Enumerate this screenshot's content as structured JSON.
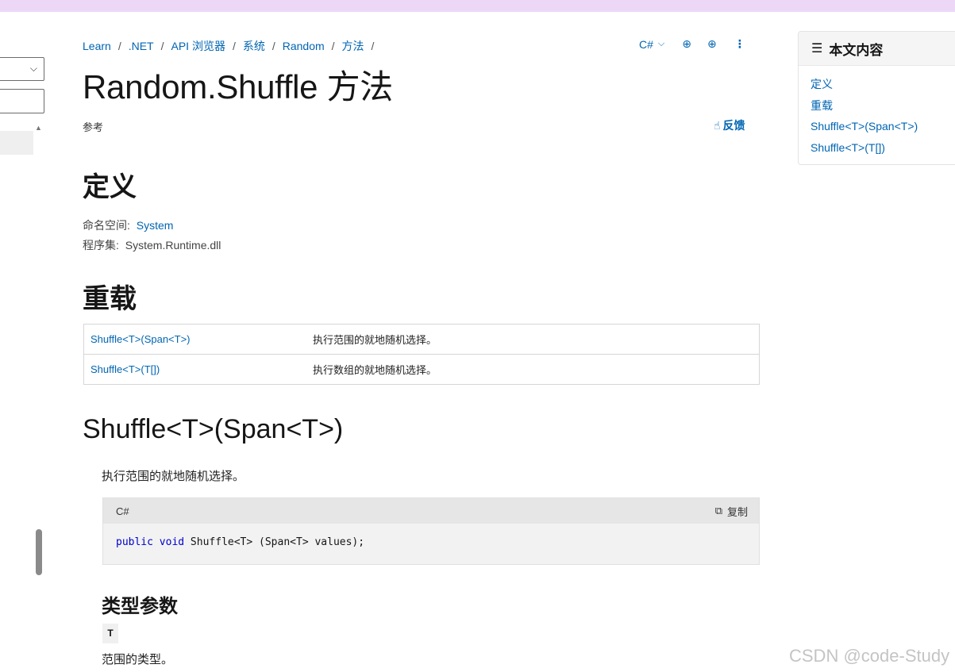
{
  "breadcrumb": [
    "Learn",
    ".NET",
    "API 浏览器",
    "系统",
    "Random",
    "方法"
  ],
  "breadcrumb_separator": "/",
  "actions": {
    "language": "C#"
  },
  "page": {
    "title": "Random.Shuffle 方法",
    "subtitle": "参考",
    "feedback": "反馈"
  },
  "definition": {
    "heading": "定义",
    "namespace_label": "命名空间:",
    "namespace_value": "System",
    "assembly_label": "程序集:",
    "assembly_value": "System.Runtime.dll"
  },
  "overloads": {
    "heading": "重载",
    "rows": [
      {
        "name": "Shuffle<T>(Span<T>)",
        "description": "执行范围的就地随机选择。"
      },
      {
        "name": "Shuffle<T>(T[])",
        "description": "执行数组的就地随机选择。"
      }
    ]
  },
  "member": {
    "heading": "Shuffle<T>(Span<T>)",
    "description": "执行范围的就地随机选择。",
    "code": {
      "language": "C#",
      "copy_label": "复制",
      "kw1": "public",
      "kw2": "void",
      "rest": " Shuffle<T> (Span<T> values);"
    },
    "type_params_heading": "类型参数",
    "type_param_name": "T",
    "type_param_desc": "范围的类型。"
  },
  "toc": {
    "heading": "本文内容",
    "items": [
      "定义",
      "重载",
      "Shuffle<T>(Span<T>)",
      "Shuffle<T>(T[])"
    ]
  },
  "watermark": "CSDN @code-Study",
  "colors": {
    "link": "#0065b3",
    "topbar": "#ecd8f6",
    "keyword": "#0000c8"
  },
  "icons": [
    "chevron-down-icon",
    "globe-icon",
    "add-circle-icon",
    "more-options-icon",
    "thumbs-up-icon",
    "copy-icon",
    "list-icon"
  ]
}
